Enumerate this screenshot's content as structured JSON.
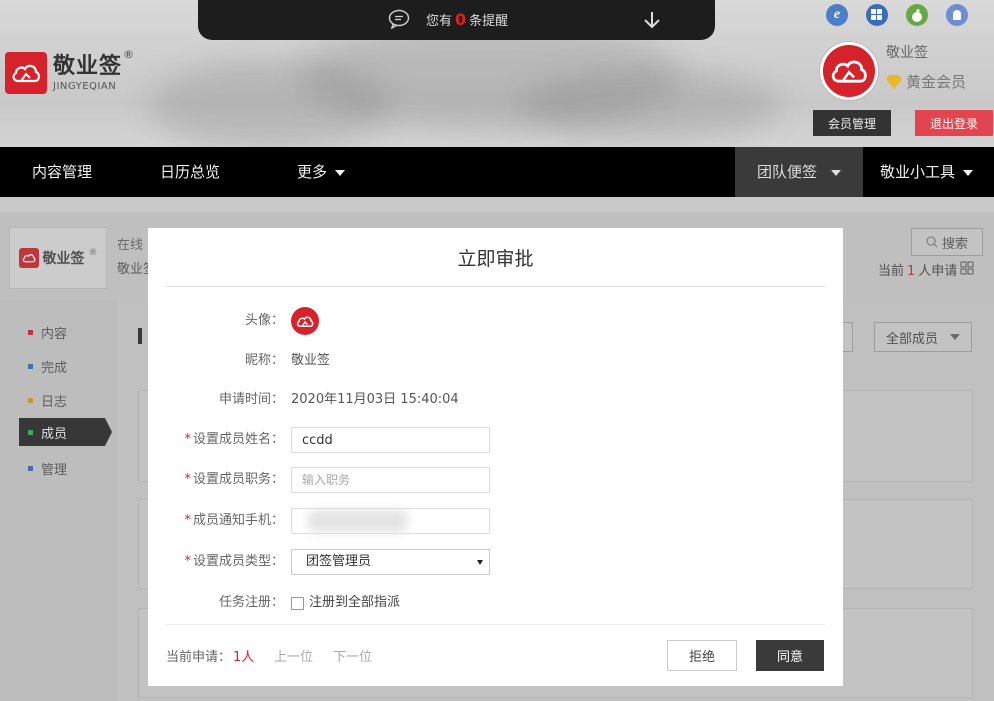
{
  "reminder": {
    "prefix": "您有",
    "count": "0",
    "suffix": "条提醒"
  },
  "logo": {
    "name_cn": "敬业签",
    "name_en": "JINGYEQIAN",
    "reg": "®"
  },
  "user": {
    "name": "敬业签",
    "level": "黄金会员",
    "member_btn": "会员管理",
    "logout_btn": "退出登录"
  },
  "nav": {
    "content": "内容管理",
    "calendar": "日历总览",
    "more": "更多",
    "team": "团队便签",
    "tools": "敬业小工具"
  },
  "subheader": {
    "logo_text": "敬业签",
    "reg": "®",
    "line1": "在线",
    "line2": "敬业签",
    "search": "搜索",
    "applicants_prefix": "当前",
    "applicants_count": "1",
    "applicants_suffix": "人申请"
  },
  "leftnav": {
    "items": [
      "内容",
      "完成",
      "日志",
      "成员",
      "管理"
    ]
  },
  "main": {
    "all_members": "全部成员"
  },
  "modal": {
    "title": "立即审批",
    "avatar_label": "头像：",
    "nickname_label": "昵称：",
    "nickname": "敬业签",
    "time_label": "申请时间：",
    "time": "2020年11月03日 15:40:04",
    "name_label": "设置成员姓名：",
    "name_value": "ccdd",
    "job_label": "设置成员职务：",
    "job_placeholder": "输入职务",
    "phone_label": "成员通知手机：",
    "type_label": "设置成员类型：",
    "type_value": "团签管理员",
    "task_label": "任务注册：",
    "task_checkbox": "注册到全部指派",
    "current_label": "当前申请：",
    "current_count": "1人",
    "prev": "上一位",
    "next": "下一位",
    "reject": "拒绝",
    "agree": "同意"
  },
  "colors": {
    "brand_red": "#d6222a",
    "logout": "#e24450",
    "nav_bg": "#000000",
    "dark_button": "#3a3a3a"
  }
}
